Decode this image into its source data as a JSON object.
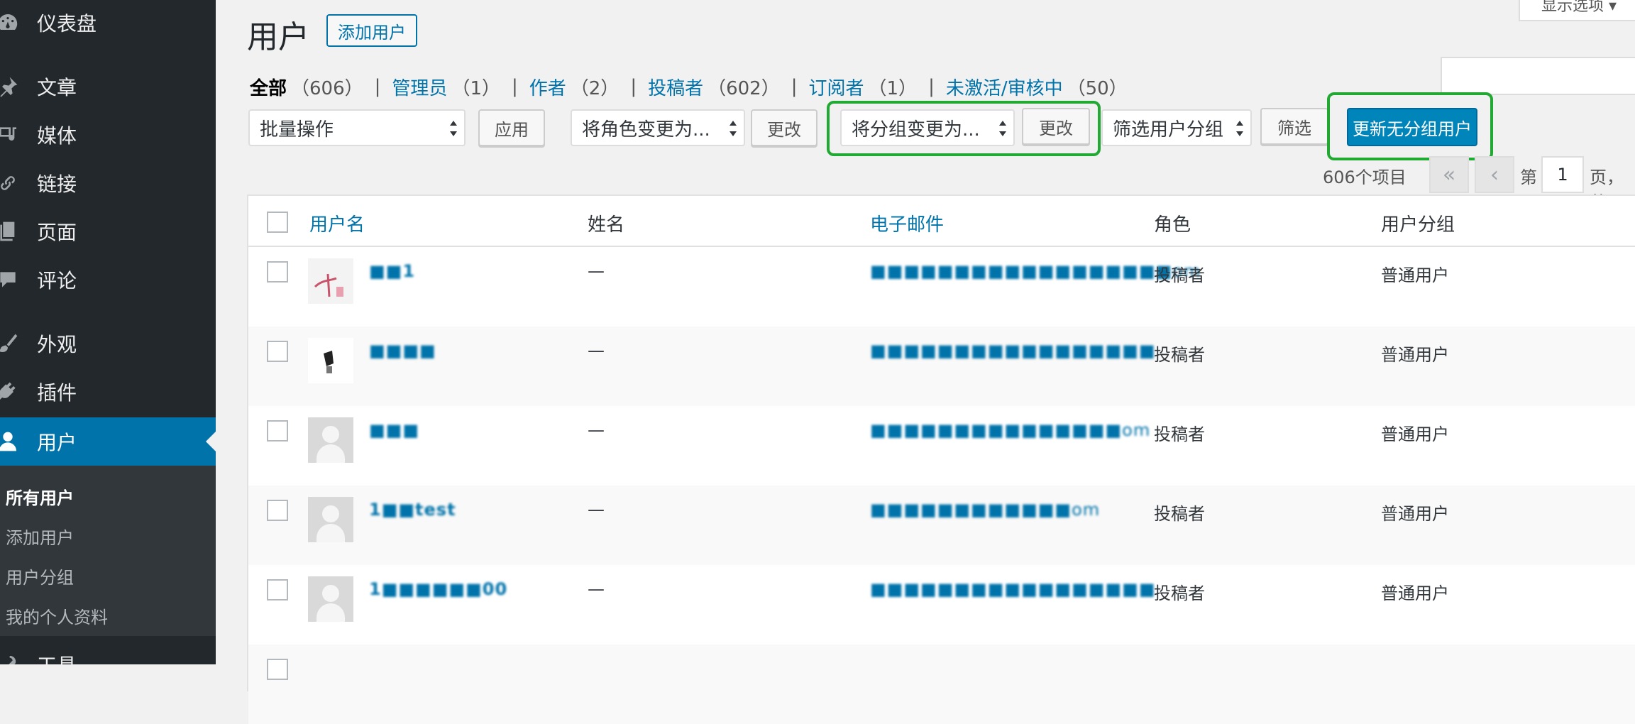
{
  "sidebar": {
    "items": [
      {
        "label": "仪表盘",
        "icon": "dashboard-icon"
      },
      {
        "label": "文章",
        "icon": "pin-icon"
      },
      {
        "label": "媒体",
        "icon": "media-icon"
      },
      {
        "label": "链接",
        "icon": "link-icon"
      },
      {
        "label": "页面",
        "icon": "page-icon"
      },
      {
        "label": "评论",
        "icon": "comment-icon"
      },
      {
        "label": "外观",
        "icon": "brush-icon"
      },
      {
        "label": "插件",
        "icon": "plugin-icon"
      },
      {
        "label": "用户",
        "icon": "user-icon"
      },
      {
        "label": "工具",
        "icon": "tools-icon"
      }
    ],
    "submenu": [
      "所有用户",
      "添加用户",
      "用户分组",
      "我的个人资料"
    ]
  },
  "header": {
    "title": "用户",
    "add_button": "添加用户",
    "screen_options": "显示选项"
  },
  "filters": [
    {
      "label": "全部",
      "count": "（606）"
    },
    {
      "label": "管理员",
      "count": "（1）"
    },
    {
      "label": "作者",
      "count": "（2）"
    },
    {
      "label": "投稿者",
      "count": "（602）"
    },
    {
      "label": "订阅者",
      "count": "（1）"
    },
    {
      "label": "未激活/审核中",
      "count": "（50）"
    }
  ],
  "separator": "|",
  "toolbar": {
    "bulk_action": "批量操作",
    "apply": "应用",
    "change_role": "将角色变更为...",
    "change_role_btn": "更改",
    "change_group": "将分组变更为...",
    "change_group_btn": "更改",
    "filter_group": "筛选用户分组",
    "filter_btn": "筛选",
    "update_ungrouped": "更新无分组用户"
  },
  "pagination": {
    "count": "606个项目",
    "first": "«",
    "prev": "‹",
    "page_prefix": "第",
    "page": "1",
    "page_suffix": "页，共"
  },
  "table": {
    "headers": [
      "用户名",
      "姓名",
      "电子邮件",
      "角色",
      "用户分组"
    ],
    "rows": [
      {
        "username": "■■1",
        "name": "—",
        "email": "■■■■■■■■■■■■■■■■■■om",
        "role": "投稿者",
        "group": "普通用户"
      },
      {
        "username": "■■■■",
        "name": "—",
        "email": "■■■■■■■■■■■■■■■■■",
        "role": "投稿者",
        "group": "普通用户"
      },
      {
        "username": "■■■",
        "name": "—",
        "email": "■■■■■■■■■■■■■■■om",
        "role": "投稿者",
        "group": "普通用户"
      },
      {
        "username": "1■■test",
        "name": "—",
        "email": "■■■■■■■■■■■■om",
        "role": "投稿者",
        "group": "普通用户"
      },
      {
        "username": "1■■■■■■00",
        "name": "—",
        "email": "■■■■■■■■■■■■■■■■■",
        "role": "投稿者",
        "group": "普通用户"
      }
    ]
  }
}
